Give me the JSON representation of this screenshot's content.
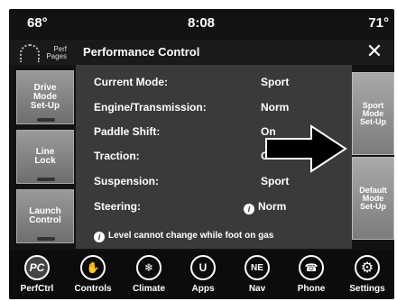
{
  "status": {
    "temp_left": "68°",
    "time": "8:08",
    "temp_right": "71°"
  },
  "header": {
    "perf_pages": "Perf Pages",
    "title": "Performance Control",
    "close": "✕"
  },
  "left_buttons": [
    "Drive Mode Set-Up",
    "Line Lock",
    "Launch Control"
  ],
  "rows": [
    {
      "label": "Current Mode:",
      "value": "Sport"
    },
    {
      "label": "Engine/Transmission:",
      "value": "Norm"
    },
    {
      "label": "Paddle Shift:",
      "value": "On"
    },
    {
      "label": "Traction:",
      "value": "On"
    },
    {
      "label": "Suspension:",
      "value": "Sport"
    },
    {
      "label": "Steering:",
      "value": "Norm"
    }
  ],
  "note": "Level cannot change while foot on gas",
  "right_buttons": [
    "Sport Mode Set-Up",
    "Default Mode Set-Up"
  ],
  "nav": [
    {
      "label": "PerfCtrl",
      "icon": "PC"
    },
    {
      "label": "Controls",
      "icon": "✋"
    },
    {
      "label": "Climate",
      "icon": "❄"
    },
    {
      "label": "Apps",
      "icon": "U"
    },
    {
      "label": "Nav",
      "icon": "NE"
    },
    {
      "label": "Phone",
      "icon": "☎"
    },
    {
      "label": "Settings",
      "icon": "⚙"
    }
  ]
}
